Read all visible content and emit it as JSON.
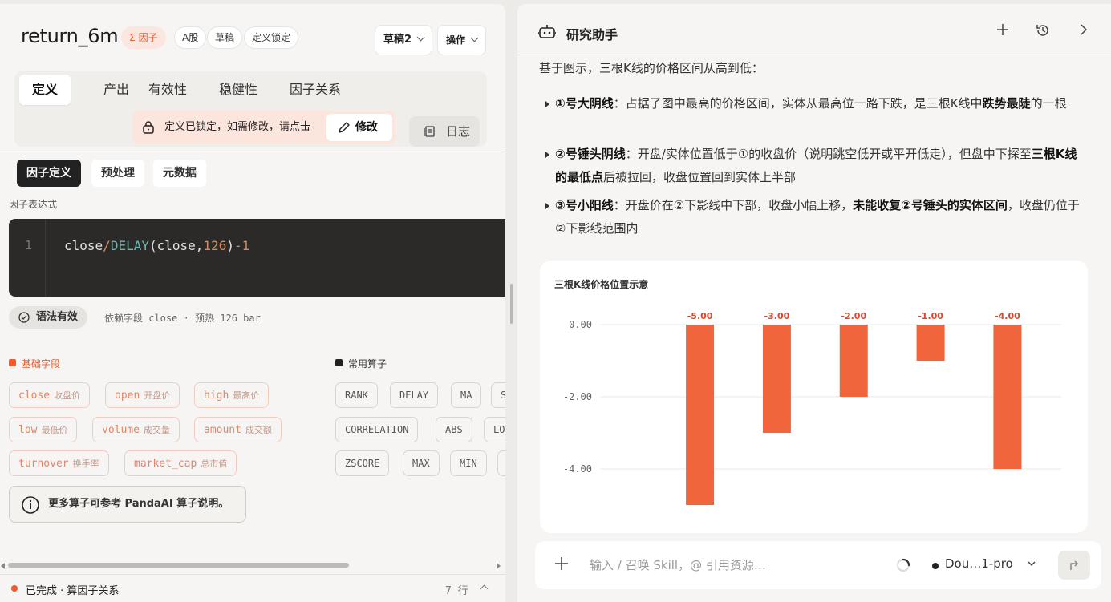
{
  "left": {
    "title": "return_6m",
    "tags": {
      "factor": "因子",
      "market": "A股",
      "status": "草稿",
      "lock": "定义锁定"
    },
    "draft_select": "草稿2",
    "ops_menu": "操作",
    "tabs": [
      "定义",
      "产出",
      "有效性",
      "稳健性",
      "因子关系"
    ],
    "lock_notice": "定义已锁定，如需修改，请点击",
    "edit_label": "修改",
    "log_label": "日志",
    "subtabs": [
      "因子定义",
      "预处理",
      "元数据"
    ],
    "expr_label": "因子表达式",
    "code": {
      "line_no": "1",
      "t1": "close",
      "t2": "/",
      "t3": "DELAY",
      "t4": "(close,",
      "t5": "126",
      "t6": ")",
      "t7": "-1"
    },
    "syntax_valid": "语法有效",
    "deps": "依赖字段 close · 预热 126 bar",
    "basic_fields_title": "基础字段",
    "basic_fields": [
      {
        "en": "close",
        "cn": "收盘价"
      },
      {
        "en": "open",
        "cn": "开盘价"
      },
      {
        "en": "high",
        "cn": "最高价"
      },
      {
        "en": "low",
        "cn": "最低价"
      },
      {
        "en": "volume",
        "cn": "成交量"
      },
      {
        "en": "amount",
        "cn": "成交额"
      },
      {
        "en": "turnover",
        "cn": "换手率"
      },
      {
        "en": "market_cap",
        "cn": "总市值"
      }
    ],
    "operators_title": "常用算子",
    "operators": [
      "RANK",
      "DELAY",
      "MA",
      "S",
      "CORRELATION",
      "ABS",
      "LO",
      "ZSCORE",
      "MAX",
      "MIN",
      ""
    ],
    "hint": "更多算子可参考 PandaAI 算子说明。",
    "status": "已完成 · 算因子关系",
    "rows": "7 行"
  },
  "right": {
    "title": "研究助手",
    "intro": "基于图示，三根K线的价格区间从高到低：",
    "bullets": [
      {
        "b1": "①号大阴线",
        "t1": "：占据了图中最高的价格区间，实体从最高位一路下跌，是三根K线中",
        "b2": "跌势最陡",
        "t2": "的一根"
      },
      {
        "b1": "②号锤头阴线",
        "t1": "：开盘/实体位置低于①的收盘价（说明跳空低开或平开低走），但盘中下探至",
        "b2": "三根K线的最低点",
        "t2": "后被拉回，收盘位置回到实体上半部"
      },
      {
        "b1": "③号小阳线",
        "t1": "：开盘价在②下影线中下部，收盘小幅上移，",
        "b2": "未能收复②号锤头的实体区间",
        "t2": "，收盘仍位于②下影线范围内"
      }
    ],
    "input_placeholder": "输入 / 召唤 Skill，@ 引用资源…",
    "model": "Dou…1-pro"
  },
  "chart_data": {
    "type": "bar",
    "title": "三根K线价格位置示意",
    "values": [
      -5.0,
      -3.0,
      -2.0,
      -1.0,
      -4.0
    ],
    "value_labels": [
      "-5.00",
      "-3.00",
      "-2.00",
      "-1.00",
      "-4.00"
    ],
    "y_ticks": [
      "0.00",
      "-2.00",
      "-4.00"
    ],
    "ylim": [
      -5.5,
      0
    ],
    "bar_color": "#f0653c",
    "label_color": "#e0452a",
    "grid": true
  },
  "colors": {
    "accent": "#f05a2a",
    "dark": "#222222"
  },
  "icons": [
    "sigma-icon",
    "lock-icon",
    "pencil-icon",
    "log-icon",
    "check-circle-icon",
    "info-icon",
    "robot-icon",
    "plus-icon",
    "history-icon",
    "chevron-right-icon",
    "spinner-icon",
    "send-icon"
  ]
}
